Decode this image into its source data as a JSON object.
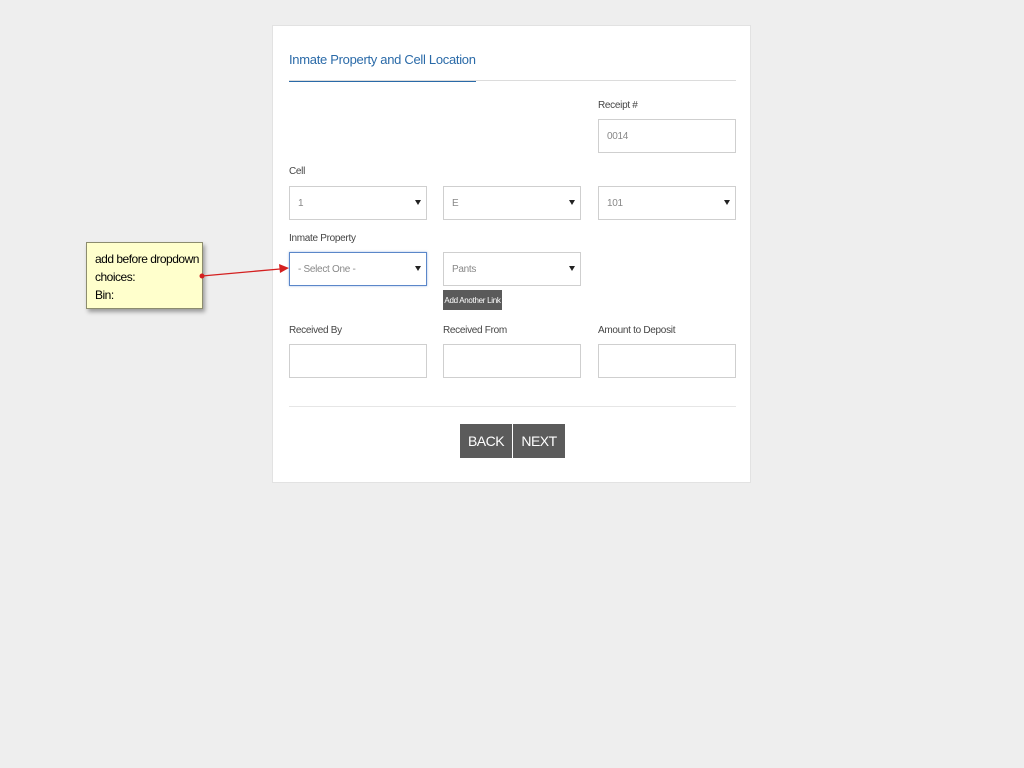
{
  "form": {
    "title": "Inmate Property and Cell Location",
    "receipt": {
      "label": "Receipt #",
      "value": "0014"
    },
    "cell": {
      "label": "Cell",
      "selects": [
        {
          "value": "1"
        },
        {
          "value": "E"
        },
        {
          "value": "101"
        }
      ]
    },
    "inmate_property": {
      "label": "Inmate Property",
      "select_one": "- Select One -",
      "item": "Pants",
      "add_link_label": "Add Another Link"
    },
    "received_by": {
      "label": "Received By",
      "value": ""
    },
    "received_from": {
      "label": "Received From",
      "value": ""
    },
    "amount_to_deposit": {
      "label": "Amount to Deposit",
      "value": ""
    },
    "back_label": "BACK",
    "next_label": "NEXT"
  },
  "annotation": {
    "lines": [
      "add before dropdown",
      "choices:",
      "Bin:"
    ],
    "arrow_color": "#d42020"
  },
  "colors": {
    "accent": "#2a6aa8",
    "button": "#5b5b5b",
    "background": "#eeeeee",
    "note_background": "#ffffcc"
  }
}
